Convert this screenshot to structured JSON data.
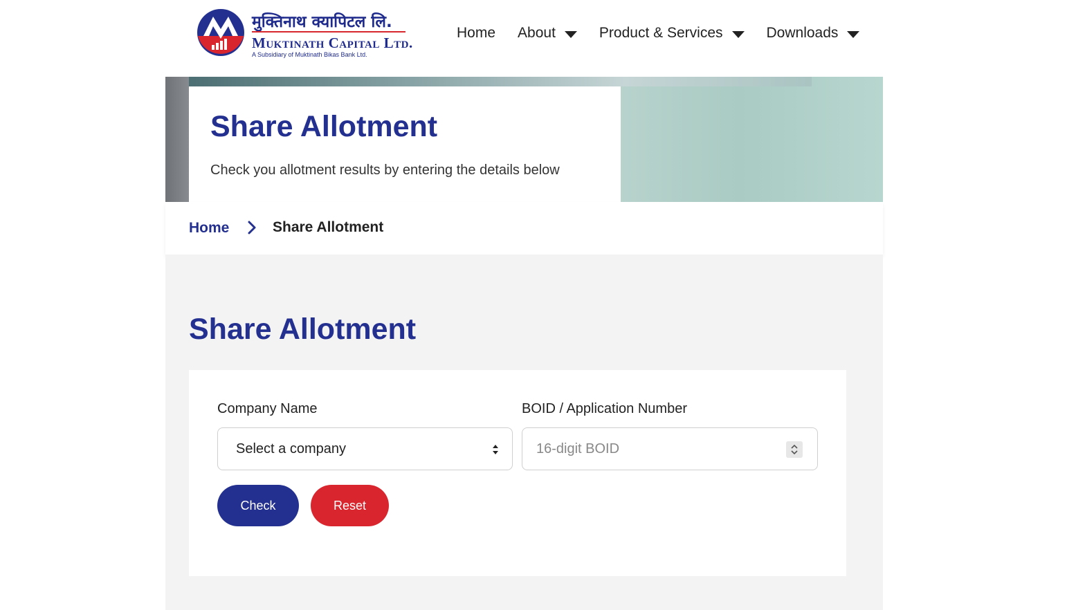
{
  "logo": {
    "nepali_name": "मुक्तिनाथ क्यापिटल लि.",
    "english_name": "Muktinath Capital Ltd.",
    "tagline": "A Subsidiary of Muktinath Bikas Bank Ltd."
  },
  "nav": {
    "items": [
      {
        "label": "Home",
        "dropdown": false
      },
      {
        "label": "About",
        "dropdown": true
      },
      {
        "label": "Product & Services",
        "dropdown": true
      },
      {
        "label": "Downloads",
        "dropdown": true
      }
    ]
  },
  "hero": {
    "title": "Share Allotment",
    "subtitle": "Check you allotment results by entering the details below"
  },
  "breadcrumb": {
    "home": "Home",
    "current": "Share Allotment"
  },
  "main": {
    "title": "Share Allotment",
    "form": {
      "company_label": "Company Name",
      "company_value": "Select a company",
      "boid_label": "BOID / Application Number",
      "boid_placeholder": "16-digit BOID",
      "check_label": "Check",
      "reset_label": "Reset"
    }
  },
  "colors": {
    "brand_blue": "#23308f",
    "brand_red": "#d9262e",
    "content_bg": "#f3f3f3"
  },
  "icons": {
    "nav_caret": "caret-down-icon",
    "breadcrumb_separator": "chevron-right-icon",
    "select_arrows": "select-arrows-icon",
    "number_spinner": "spinner-icon"
  }
}
